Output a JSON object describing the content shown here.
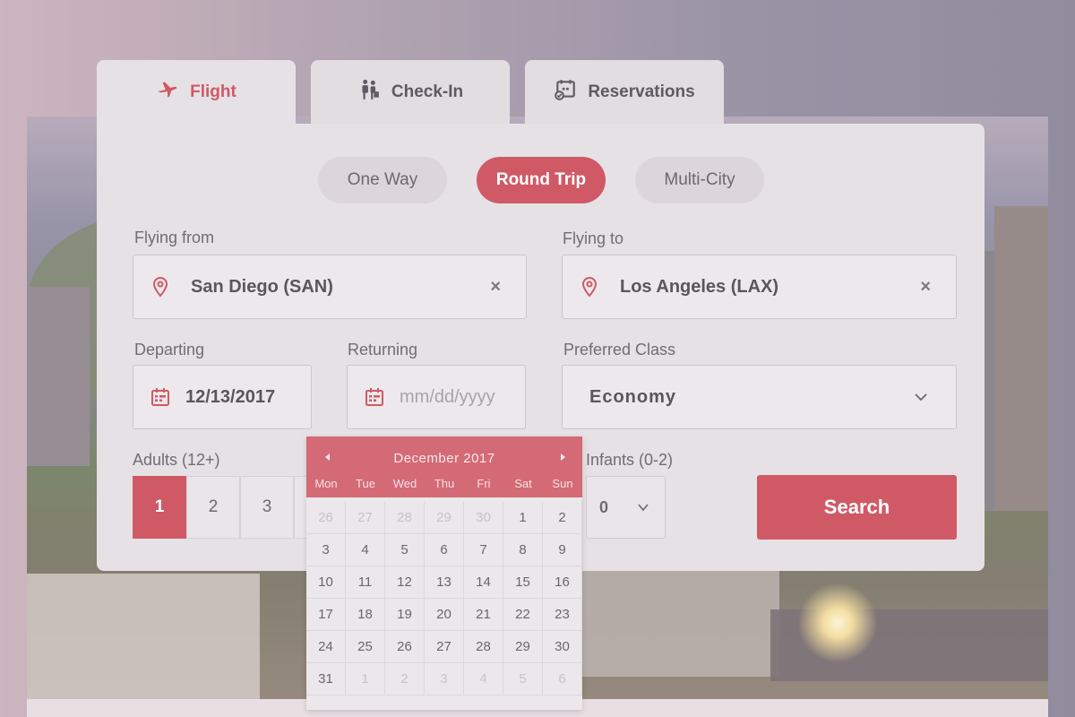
{
  "tabs": [
    {
      "label": "Flight",
      "icon": "airplane-icon"
    },
    {
      "label": "Check-In",
      "icon": "checkin-icon"
    },
    {
      "label": "Reservations",
      "icon": "calendar-check-icon"
    }
  ],
  "trip_types": [
    "One Way",
    "Round Trip",
    "Multi-City"
  ],
  "active_trip": "Round Trip",
  "from": {
    "label": "Flying from",
    "value": "San Diego (SAN)",
    "clear": "×"
  },
  "to": {
    "label": "Flying to",
    "value": "Los Angeles (LAX)",
    "clear": "×"
  },
  "departing": {
    "label": "Departing",
    "value": "12/13/2017"
  },
  "returning": {
    "label": "Returning",
    "placeholder": "mm/dd/yyyy"
  },
  "class": {
    "label": "Preferred Class",
    "value": "Economy"
  },
  "adults": {
    "label": "Adults (12+)",
    "options": [
      "1",
      "2",
      "3"
    ],
    "selected": "1"
  },
  "infants": {
    "label": "Infants (0-2)",
    "value": "0"
  },
  "search_label": "Search",
  "calendar": {
    "title": "December 2017",
    "weekdays": [
      "Mon",
      "Tue",
      "Wed",
      "Thu",
      "Fri",
      "Sat",
      "Sun"
    ],
    "leading": [
      "26",
      "27",
      "28",
      "29",
      "30"
    ],
    "days": [
      "1",
      "2",
      "3",
      "4",
      "5",
      "6",
      "7",
      "8",
      "9",
      "10",
      "11",
      "12",
      "13",
      "14",
      "15",
      "16",
      "17",
      "18",
      "19",
      "20",
      "21",
      "22",
      "23",
      "24",
      "25",
      "26",
      "27",
      "28",
      "29",
      "30",
      "31"
    ],
    "trailing": [
      "1",
      "2",
      "3",
      "4",
      "5",
      "6"
    ]
  },
  "colors": {
    "accent": "#cf5a66",
    "panel": "#e6e1e5"
  }
}
